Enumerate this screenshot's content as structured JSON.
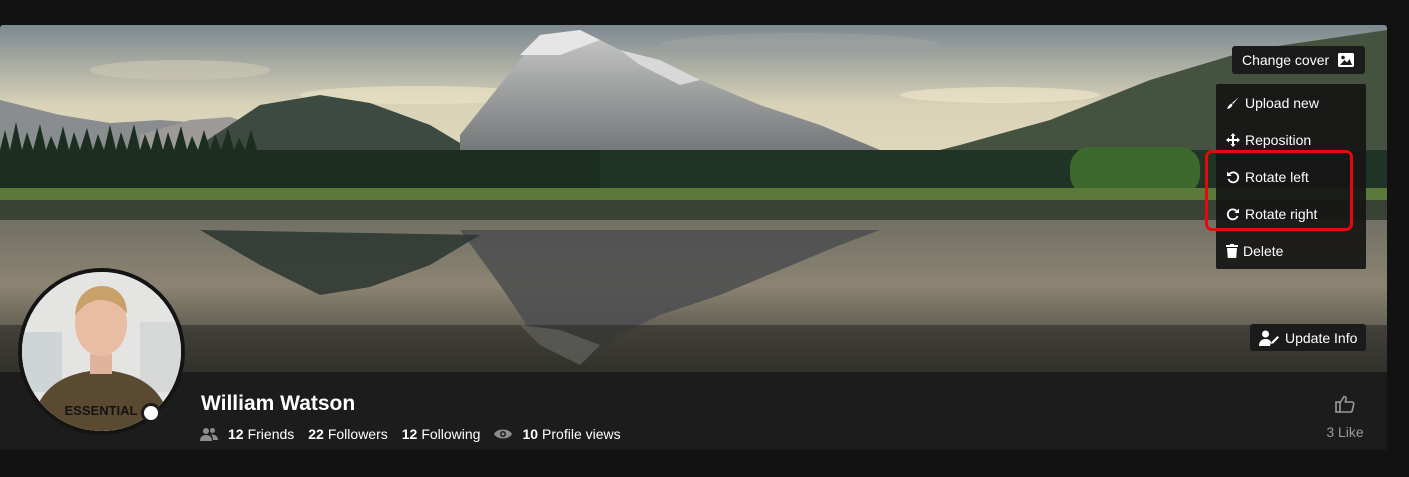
{
  "cover": {
    "change_cover_label": "Change cover",
    "menu": [
      {
        "label": "Upload new",
        "icon": "brush-icon"
      },
      {
        "label": "Reposition",
        "icon": "move-arrows-icon"
      },
      {
        "label": "Rotate left",
        "icon": "rotate-left-icon"
      },
      {
        "label": "Rotate right",
        "icon": "rotate-right-icon"
      },
      {
        "label": "Delete",
        "icon": "trash-icon"
      }
    ],
    "update_info_label": "Update Info"
  },
  "profile": {
    "name": "William Watson",
    "friends_count": "12",
    "friends_label": "Friends",
    "followers_count": "22",
    "followers_label": "Followers",
    "following_count": "12",
    "following_label": "Following",
    "views_count": "10",
    "views_label": "Profile views",
    "shirt_text": "ESSENTIAL"
  },
  "like": {
    "count_label": "3 Like"
  },
  "colors": {
    "page_bg": "#121212",
    "card_bg": "#1c1c1c",
    "highlight": "#e40a0a",
    "muted": "#9a9a9a"
  }
}
